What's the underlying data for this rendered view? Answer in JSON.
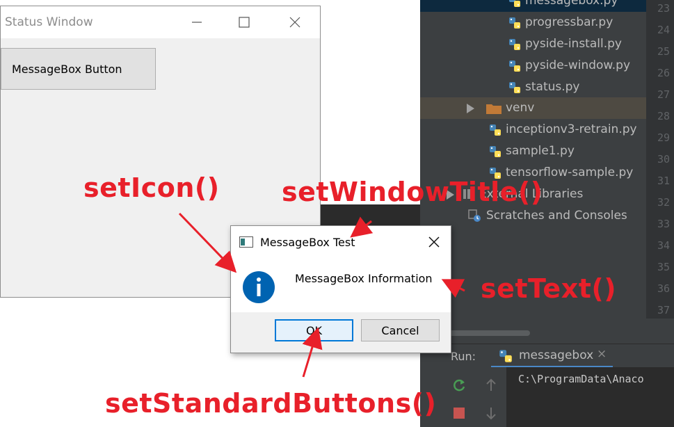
{
  "ide": {
    "tree": [
      {
        "label": "messagebox.py",
        "kind": "py",
        "indent": 1
      },
      {
        "label": "progressbar.py",
        "kind": "py",
        "indent": 1
      },
      {
        "label": "pyside-install.py",
        "kind": "py",
        "indent": 1
      },
      {
        "label": "pyside-window.py",
        "kind": "py",
        "indent": 1
      },
      {
        "label": "status.py",
        "kind": "py",
        "indent": 1
      },
      {
        "label": "venv",
        "kind": "folder",
        "indent": 0
      },
      {
        "label": "inceptionv3-retrain.py",
        "kind": "py",
        "indent": 0
      },
      {
        "label": "sample1.py",
        "kind": "py",
        "indent": 0
      },
      {
        "label": "tensorflow-sample.py",
        "kind": "py",
        "indent": 0
      },
      {
        "label": "External Libraries",
        "kind": "lib",
        "indent": 0
      },
      {
        "label": "Scratches and Consoles",
        "kind": "scratch",
        "indent": 0
      }
    ],
    "line_numbers": [
      "23",
      "24",
      "25",
      "26",
      "27",
      "28",
      "29",
      "30",
      "31",
      "32",
      "33",
      "34",
      "35",
      "36",
      "37"
    ],
    "run_label": "Run:",
    "run_tab_label": "messagebox",
    "run_tab_close": "×",
    "console_text": "C:\\ProgramData\\Anaco",
    "colors": {
      "python_blue": "#4584b6",
      "python_yellow": "#ffde57",
      "folder": "#c17a37",
      "run_green": "#499c54",
      "stop_red": "#c75450"
    }
  },
  "status_window": {
    "title": "Status Window",
    "button_label": "MessageBox Button"
  },
  "messagebox": {
    "title": "MessageBox Test",
    "text": "MessageBox Information",
    "ok_label": "OK",
    "cancel_label": "Cancel",
    "icon": "information-icon",
    "info_color": "#0063b1"
  },
  "annotations": {
    "set_icon": "setIcon()",
    "set_window_title": "setWindowTitle()",
    "set_text": "setText()",
    "set_standard_buttons": "setStandardButtons()",
    "color": "#e8202a"
  }
}
